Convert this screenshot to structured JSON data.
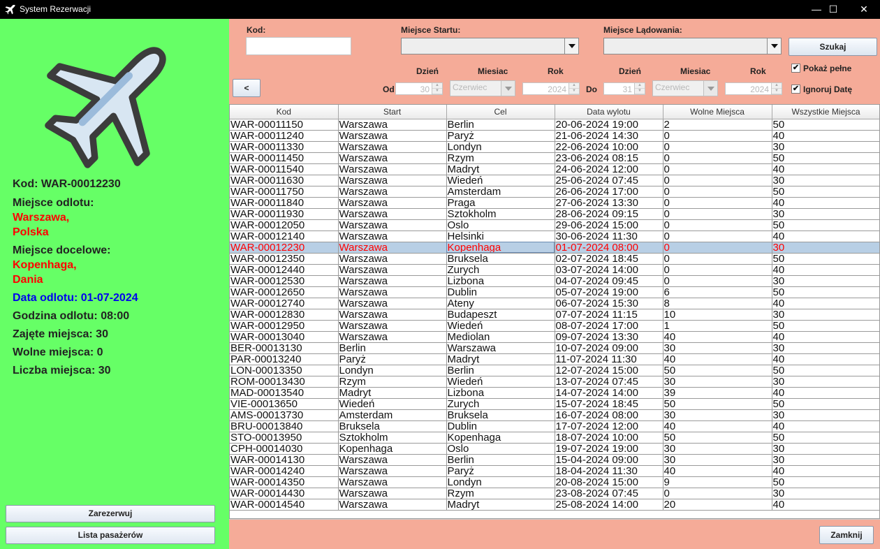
{
  "window": {
    "title": "System Rezerwacji",
    "minimize": "—",
    "maximize": "☐",
    "close": "✕"
  },
  "details": {
    "code": "Kod: WAR-00012230",
    "departure_label": "Miejsce odlotu:",
    "departure_city": "Warszawa,",
    "departure_country": "Polska",
    "destination_label": "Miejsce docelowe:",
    "destination_city": "Kopenhaga,",
    "destination_country": "Dania",
    "date": "Data odlotu: 01-07-2024",
    "time": "Godzina odlotu: 08:00",
    "occupied": "Zajęte miejsca: 30",
    "free": "Wolne miejsca: 0",
    "total": "Liczba miejsca: 30"
  },
  "left_buttons": {
    "reserve": "Zarezerwuj",
    "passengers": "Lista pasażerów"
  },
  "search": {
    "code_label": "Kod:",
    "code_value": "",
    "start_label": "Miejsce Startu:",
    "landing_label": "Miejsce Lądowania:",
    "search_button": "Szukaj",
    "back_button": "<",
    "from_label": "Od",
    "to_label": "Do",
    "day_label": "Dzień",
    "month_label": "Miesiac",
    "year_label": "Rok",
    "from_day": "30",
    "from_month": "Czerwiec",
    "from_year": "2024",
    "to_day": "31",
    "to_month": "Czerwiec",
    "to_year": "2024",
    "show_full": "Pokaż pełne",
    "ignore_date": "Ignoruj Datę",
    "check_mark": "✔"
  },
  "table": {
    "headers": [
      "Kod",
      "Start",
      "Cel",
      "Data wylotu",
      "Wolne Miejsca",
      "Wszystkie Miejsca"
    ],
    "selected_index": 11,
    "rows": [
      [
        "WAR-00011150",
        "Warszawa",
        "Berlin",
        "20-06-2024 19:00",
        "2",
        "50"
      ],
      [
        "WAR-00011240",
        "Warszawa",
        "Paryż",
        "21-06-2024 14:30",
        "0",
        "40"
      ],
      [
        "WAR-00011330",
        "Warszawa",
        "Londyn",
        "22-06-2024 10:00",
        "0",
        "30"
      ],
      [
        "WAR-00011450",
        "Warszawa",
        "Rzym",
        "23-06-2024 08:15",
        "0",
        "50"
      ],
      [
        "WAR-00011540",
        "Warszawa",
        "Madryt",
        "24-06-2024 12:00",
        "0",
        "40"
      ],
      [
        "WAR-00011630",
        "Warszawa",
        "Wiedeń",
        "25-06-2024 07:45",
        "0",
        "30"
      ],
      [
        "WAR-00011750",
        "Warszawa",
        "Amsterdam",
        "26-06-2024 17:00",
        "0",
        "50"
      ],
      [
        "WAR-00011840",
        "Warszawa",
        "Praga",
        "27-06-2024 13:30",
        "0",
        "40"
      ],
      [
        "WAR-00011930",
        "Warszawa",
        "Sztokholm",
        "28-06-2024 09:15",
        "0",
        "30"
      ],
      [
        "WAR-00012050",
        "Warszawa",
        "Oslo",
        "29-06-2024 15:00",
        "0",
        "50"
      ],
      [
        "WAR-00012140",
        "Warszawa",
        "Helsinki",
        "30-06-2024 11:30",
        "0",
        "40"
      ],
      [
        "WAR-00012230",
        "Warszawa",
        "Kopenhaga",
        "01-07-2024 08:00",
        "0",
        "30"
      ],
      [
        "WAR-00012350",
        "Warszawa",
        "Bruksela",
        "02-07-2024 18:45",
        "0",
        "50"
      ],
      [
        "WAR-00012440",
        "Warszawa",
        "Zurych",
        "03-07-2024 14:00",
        "0",
        "40"
      ],
      [
        "WAR-00012530",
        "Warszawa",
        "Lizbona",
        "04-07-2024 09:45",
        "0",
        "30"
      ],
      [
        "WAR-00012650",
        "Warszawa",
        "Dublin",
        "05-07-2024 19:00",
        "6",
        "50"
      ],
      [
        "WAR-00012740",
        "Warszawa",
        "Ateny",
        "06-07-2024 15:30",
        "8",
        "40"
      ],
      [
        "WAR-00012830",
        "Warszawa",
        "Budapeszt",
        "07-07-2024 11:15",
        "10",
        "30"
      ],
      [
        "WAR-00012950",
        "Warszawa",
        "Wiedeń",
        "08-07-2024 17:00",
        "1",
        "50"
      ],
      [
        "WAR-00013040",
        "Warszawa",
        "Mediolan",
        "09-07-2024 13:30",
        "40",
        "40"
      ],
      [
        "BER-00013130",
        "Berlin",
        "Warszawa",
        "10-07-2024 09:00",
        "30",
        "30"
      ],
      [
        "PAR-00013240",
        "Paryż",
        "Madryt",
        "11-07-2024 11:30",
        "40",
        "40"
      ],
      [
        "LON-00013350",
        "Londyn",
        "Berlin",
        "12-07-2024 15:00",
        "50",
        "50"
      ],
      [
        "ROM-00013430",
        "Rzym",
        "Wiedeń",
        "13-07-2024 07:45",
        "30",
        "30"
      ],
      [
        "MAD-00013540",
        "Madryt",
        "Lizbona",
        "14-07-2024 14:00",
        "39",
        "40"
      ],
      [
        "VIE-00013650",
        "Wiedeń",
        "Zurych",
        "15-07-2024 18:45",
        "50",
        "50"
      ],
      [
        "AMS-00013730",
        "Amsterdam",
        "Bruksela",
        "16-07-2024 08:00",
        "30",
        "30"
      ],
      [
        "BRU-00013840",
        "Bruksela",
        "Dublin",
        "17-07-2024 12:00",
        "40",
        "40"
      ],
      [
        "STO-00013950",
        "Sztokholm",
        "Kopenhaga",
        "18-07-2024 10:00",
        "50",
        "50"
      ],
      [
        "CPH-00014030",
        "Kopenhaga",
        "Oslo",
        "19-07-2024 19:00",
        "30",
        "30"
      ],
      [
        "WAR-00014130",
        "Warszawa",
        "Berlin",
        "15-04-2024 09:00",
        "30",
        "30"
      ],
      [
        "WAR-00014240",
        "Warszawa",
        "Paryż",
        "18-04-2024 11:30",
        "40",
        "40"
      ],
      [
        "WAR-00014350",
        "Warszawa",
        "Londyn",
        "20-08-2024 15:00",
        "9",
        "50"
      ],
      [
        "WAR-00014430",
        "Warszawa",
        "Rzym",
        "23-08-2024 07:45",
        "0",
        "30"
      ],
      [
        "WAR-00014540",
        "Warszawa",
        "Madryt",
        "25-08-2024 14:00",
        "20",
        "40"
      ]
    ]
  },
  "close_button": "Zamknij",
  "colors": {
    "left_bg": "#66ff66",
    "right_bg": "#f5ab98",
    "selected_row": "#b8cfe5",
    "highlight_red": "#ff0000",
    "date_blue": "#0000ee"
  },
  "icons": {
    "app": "airplane-icon",
    "illustration": "airplane-icon"
  }
}
